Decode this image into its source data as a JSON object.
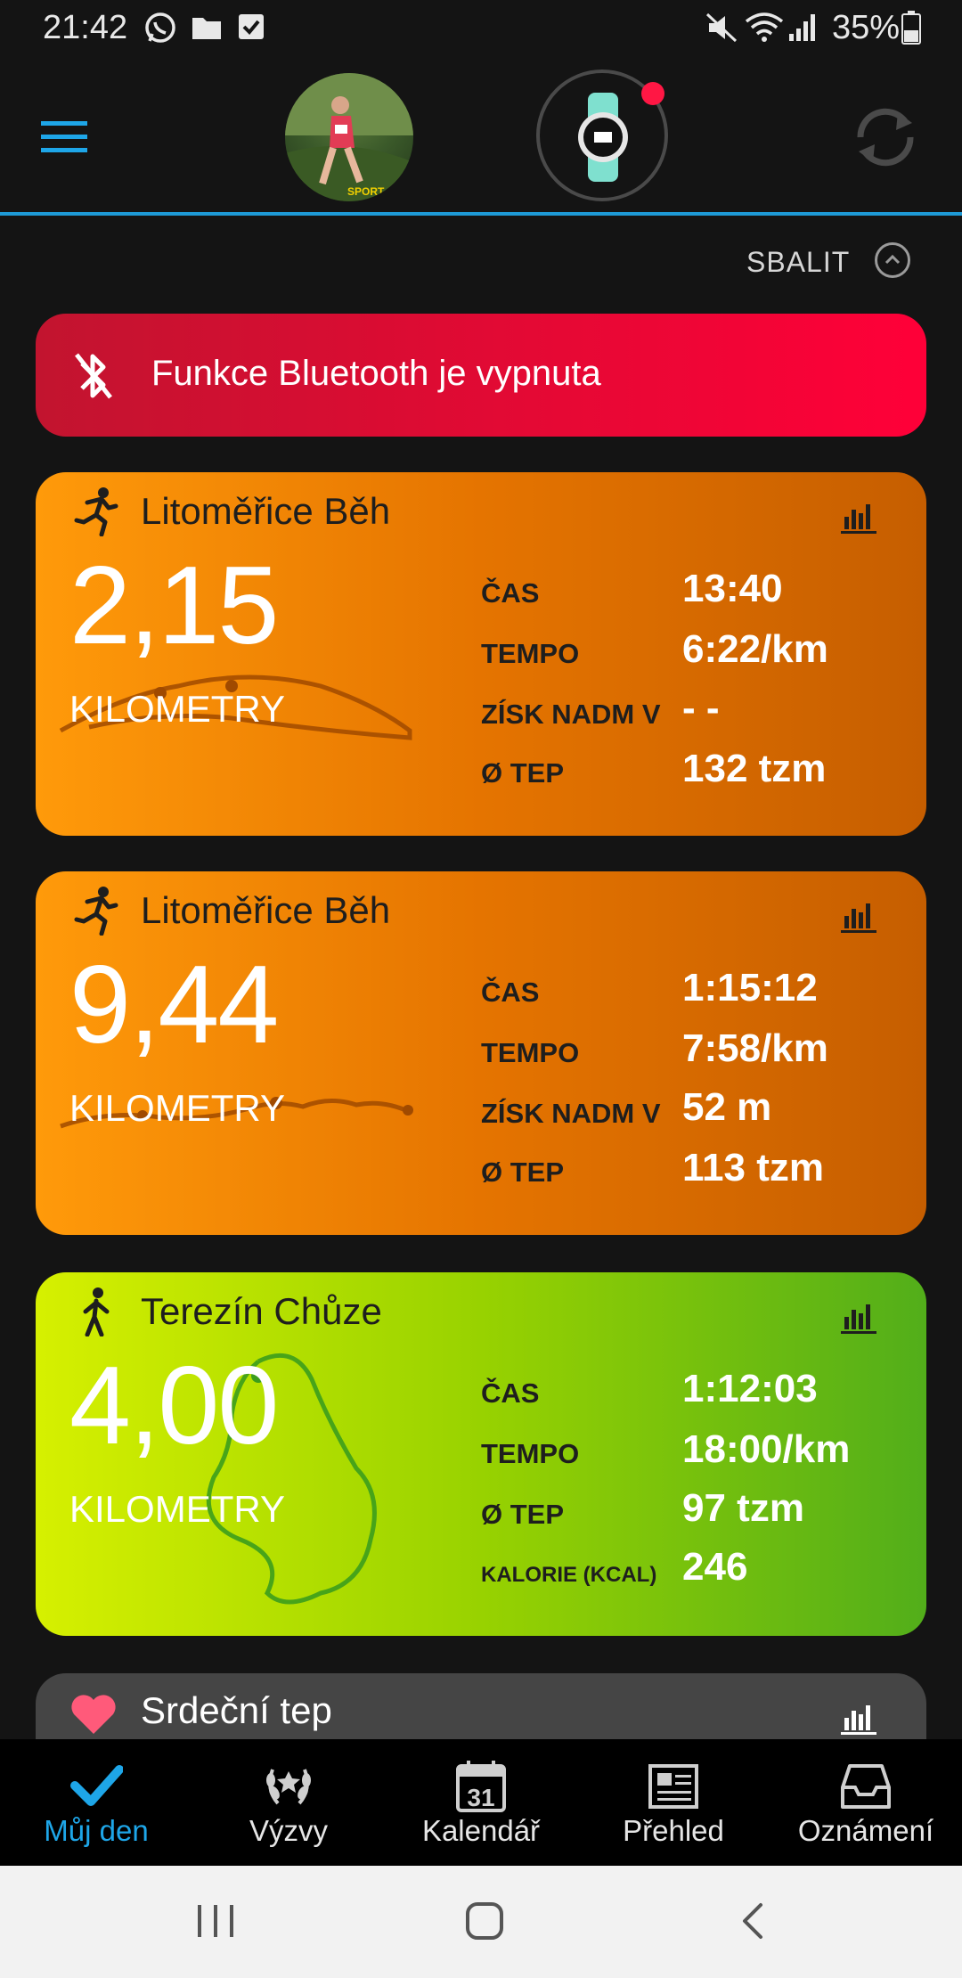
{
  "status_bar": {
    "time": "21:42",
    "battery": "35%",
    "icons": [
      "whatsapp-icon",
      "folder-icon",
      "checkbox-icon",
      "mute-icon",
      "wifi-icon",
      "signal-icon",
      "battery-icon"
    ]
  },
  "header": {
    "menu_icon": "hamburger-menu-icon",
    "avatar_label": "SPORT",
    "watch_has_alert": true,
    "sync_icon": "sync-icon"
  },
  "collapse": {
    "label": "SBALIT",
    "icon": "chevron-up-icon"
  },
  "bluetooth_alert": {
    "text": "Funkce Bluetooth je vypnuta",
    "icon": "bluetooth-off-icon"
  },
  "activities": [
    {
      "title": "Litoměřice Běh",
      "icon": "running-icon",
      "distance": "2,15",
      "unit": "KILOMETRY",
      "stats": [
        {
          "label": "ČAS",
          "value": "13:40"
        },
        {
          "label": "TEMPO",
          "value": "6:22/km"
        },
        {
          "label": "ZÍSK NADM V",
          "value": "- -"
        },
        {
          "label": "Ø TEP",
          "value": "132 tzm"
        }
      ]
    },
    {
      "title": "Litoměřice Běh",
      "icon": "running-icon",
      "distance": "9,44",
      "unit": "KILOMETRY",
      "stats": [
        {
          "label": "ČAS",
          "value": "1:15:12"
        },
        {
          "label": "TEMPO",
          "value": "7:58/km"
        },
        {
          "label": "ZÍSK NADM V",
          "value": "52 m"
        },
        {
          "label": "Ø TEP",
          "value": "113 tzm"
        }
      ]
    },
    {
      "title": "Terezín Chůze",
      "icon": "walking-icon",
      "distance": "4,00",
      "unit": "KILOMETRY",
      "stats": [
        {
          "label": "ČAS",
          "value": "1:12:03"
        },
        {
          "label": "TEMPO",
          "value": "18:00/km"
        },
        {
          "label": "Ø TEP",
          "value": "97 tzm"
        },
        {
          "label": "KALORIE (KCAL)",
          "value": "246"
        }
      ]
    }
  ],
  "heart_card": {
    "title": "Srdeční tep",
    "icon": "heart-icon"
  },
  "bottom_nav": [
    {
      "label": "Můj den",
      "icon": "checkmark-icon",
      "active": true
    },
    {
      "label": "Výzvy",
      "icon": "laurel-icon",
      "active": false
    },
    {
      "label": "Kalendář",
      "icon": "calendar-icon",
      "day": "31",
      "active": false
    },
    {
      "label": "Přehled",
      "icon": "newspaper-icon",
      "active": false
    },
    {
      "label": "Oznámení",
      "icon": "inbox-icon",
      "active": false
    }
  ],
  "colors": {
    "accent": "#1ea6e8",
    "bluetooth_alert": "#ff0038",
    "run_card": "#e57400",
    "walk_card": "#98d200"
  }
}
